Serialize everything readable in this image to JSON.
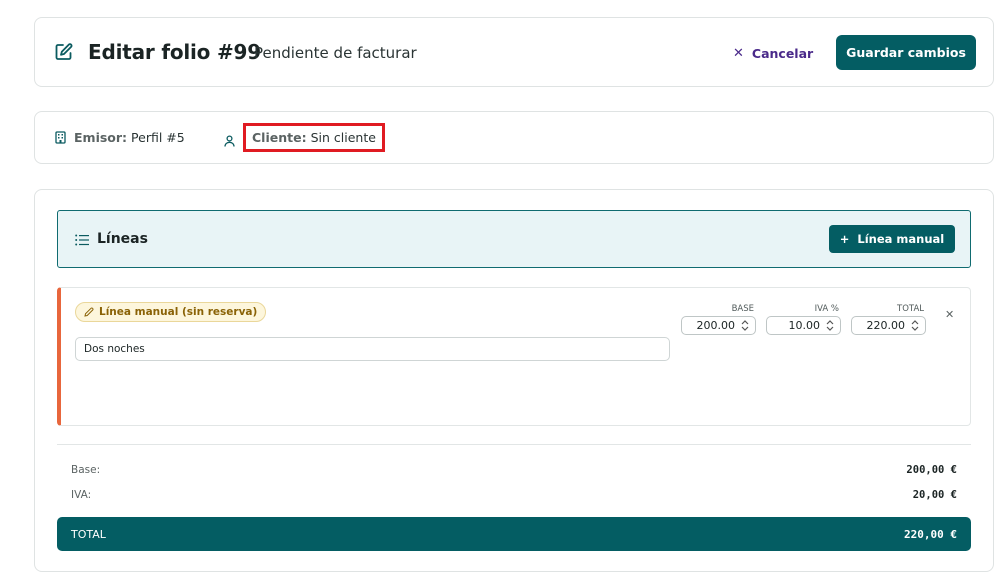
{
  "header": {
    "title": "Editar folio #99",
    "status": "Pendiente de facturar",
    "cancel_label": "Cancelar",
    "save_label": "Guardar cambios",
    "icon": "edit-icon"
  },
  "info": {
    "emisor_label": "Emisor:",
    "emisor_value": "Perfil #5",
    "cliente_label": "Cliente:",
    "cliente_value": "Sin cliente"
  },
  "lines": {
    "title": "Líneas",
    "add_label": "Línea manual",
    "items": [
      {
        "badge": "Línea manual (sin reserva)",
        "description": "Dos noches",
        "base_label": "BASE",
        "base": "200.00",
        "iva_label": "IVA %",
        "iva": "10.00",
        "total_label": "TOTAL",
        "total": "220.00"
      }
    ]
  },
  "summary": {
    "base_label": "Base:",
    "base_value": "200,00 €",
    "iva_label": "IVA:",
    "iva_value": "20,00 €",
    "total_label": "TOTAL",
    "total_value": "220,00 €"
  },
  "colors": {
    "primary": "#045d63",
    "accent_cancel": "#4a2a8a",
    "line_marker": "#e8663c",
    "highlight": "#e01b22"
  }
}
